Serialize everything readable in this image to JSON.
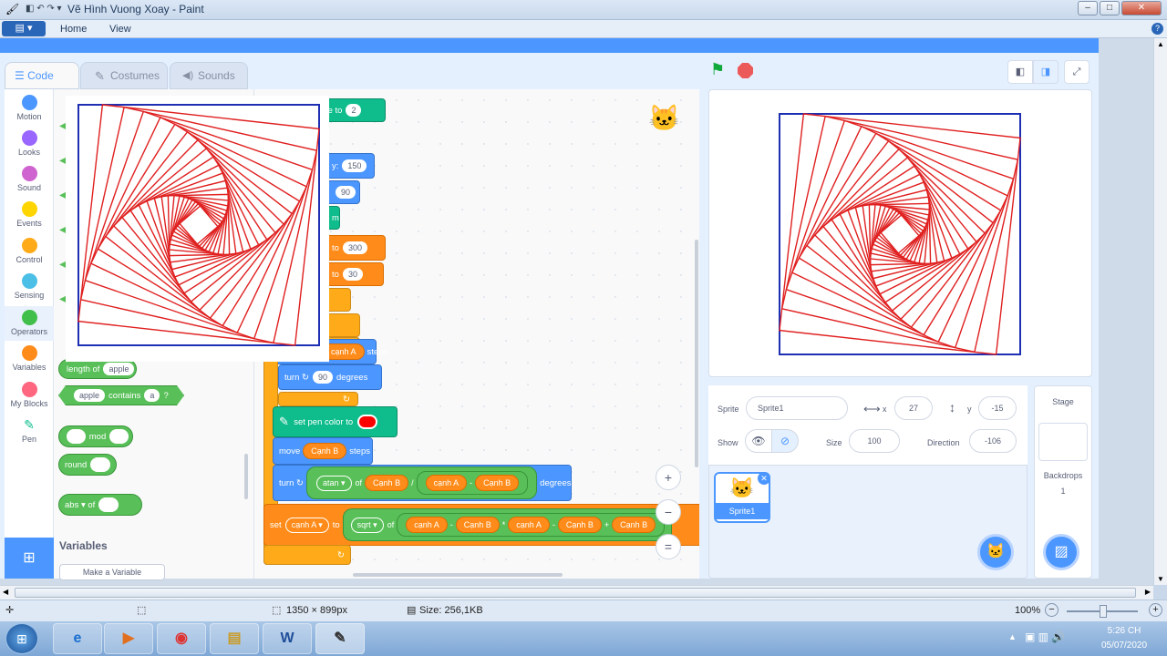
{
  "window": {
    "title": "Vẽ Hình Vuong Xoay - Paint",
    "minimize": "–",
    "maximize": "□",
    "close": "✕",
    "help": "?"
  },
  "ribbon": {
    "home": "Home",
    "view": "View"
  },
  "tabs": {
    "code": "Code",
    "costumes": "Costumes",
    "sounds": "Sounds"
  },
  "categories": [
    {
      "label": "Motion",
      "color": "#4c97ff"
    },
    {
      "label": "Looks",
      "color": "#9966ff"
    },
    {
      "label": "Sound",
      "color": "#cf63cf"
    },
    {
      "label": "Events",
      "color": "#ffd500"
    },
    {
      "label": "Control",
      "color": "#ffab19"
    },
    {
      "label": "Sensing",
      "color": "#4cbfe6"
    },
    {
      "label": "Operators",
      "color": "#40bf4a"
    },
    {
      "label": "Variables",
      "color": "#ff8c1a"
    },
    {
      "label": "My Blocks",
      "color": "#ff6680"
    },
    {
      "label": "Pen",
      "color": "#0fbd8c"
    }
  ],
  "palette": {
    "length_of": "length of",
    "apple": "apple",
    "contains": "contains",
    "a": "a",
    "q": "?",
    "mod": "mod",
    "round": "round",
    "abs": "abs ▾",
    "of": "of",
    "variables_heading": "Variables",
    "make_variable": "Make a Variable"
  },
  "script": {
    "size_to": "size to",
    "size_val": "2",
    "y_label": "y:",
    "y_val": "150",
    "dir_val": "90",
    "m_text": "m",
    "to1": "to",
    "to1_val": "300",
    "to2": "to",
    "to2_val": "30",
    "move1_var": "cạnh A",
    "steps1": "steps",
    "turn_label": "turn",
    "turn_val": "90",
    "degrees": "degrees",
    "loop_arrow": "↻",
    "set_pen_color": "set pen color to",
    "move2_label": "move",
    "move2_var": "Cạnh B",
    "steps2": "steps",
    "turn2_label": "turn",
    "atan": "atan ▾",
    "of": "of",
    "canhB1": "Cạnh B",
    "div": "/",
    "canhA1": "cạnh A",
    "minus1": "-",
    "canhB2": "Cạnh B",
    "degrees2": "degrees",
    "set_label": "set",
    "set_var": "cạnh A ▾",
    "to3": "to",
    "sqrt": "sqrt ▾",
    "of2": "of",
    "e1": "cạnh A",
    "e2": "-",
    "e3": "Cạnh B",
    "e4": "*",
    "e5": "cạnh A",
    "e6": "-",
    "e7": "Cạnh B",
    "e8": "+",
    "e9": "Cạnh B"
  },
  "zoom": {
    "in": "+",
    "out": "−",
    "reset": "="
  },
  "sprite": {
    "sprite_label": "Sprite",
    "sprite_name": "Sprite1",
    "x_label": "x",
    "x_val": "27",
    "y_label": "y",
    "y_val": "-15",
    "show_label": "Show",
    "size_label": "Size",
    "size_val": "100",
    "direction_label": "Direction",
    "direction_val": "-106",
    "thumb_name": "Sprite1"
  },
  "stage_panel": {
    "title": "Stage",
    "backdrops_label": "Backdrops",
    "backdrops_count": "1"
  },
  "status": {
    "dims": "1350 × 899px",
    "size": "Size: 256,1KB",
    "zoom": "100%"
  },
  "clock": {
    "time": "5:26 CH",
    "date": "05/07/2020"
  },
  "taskbar_items": [
    "e",
    "▶",
    "◉",
    "▤",
    "W",
    "✎"
  ]
}
